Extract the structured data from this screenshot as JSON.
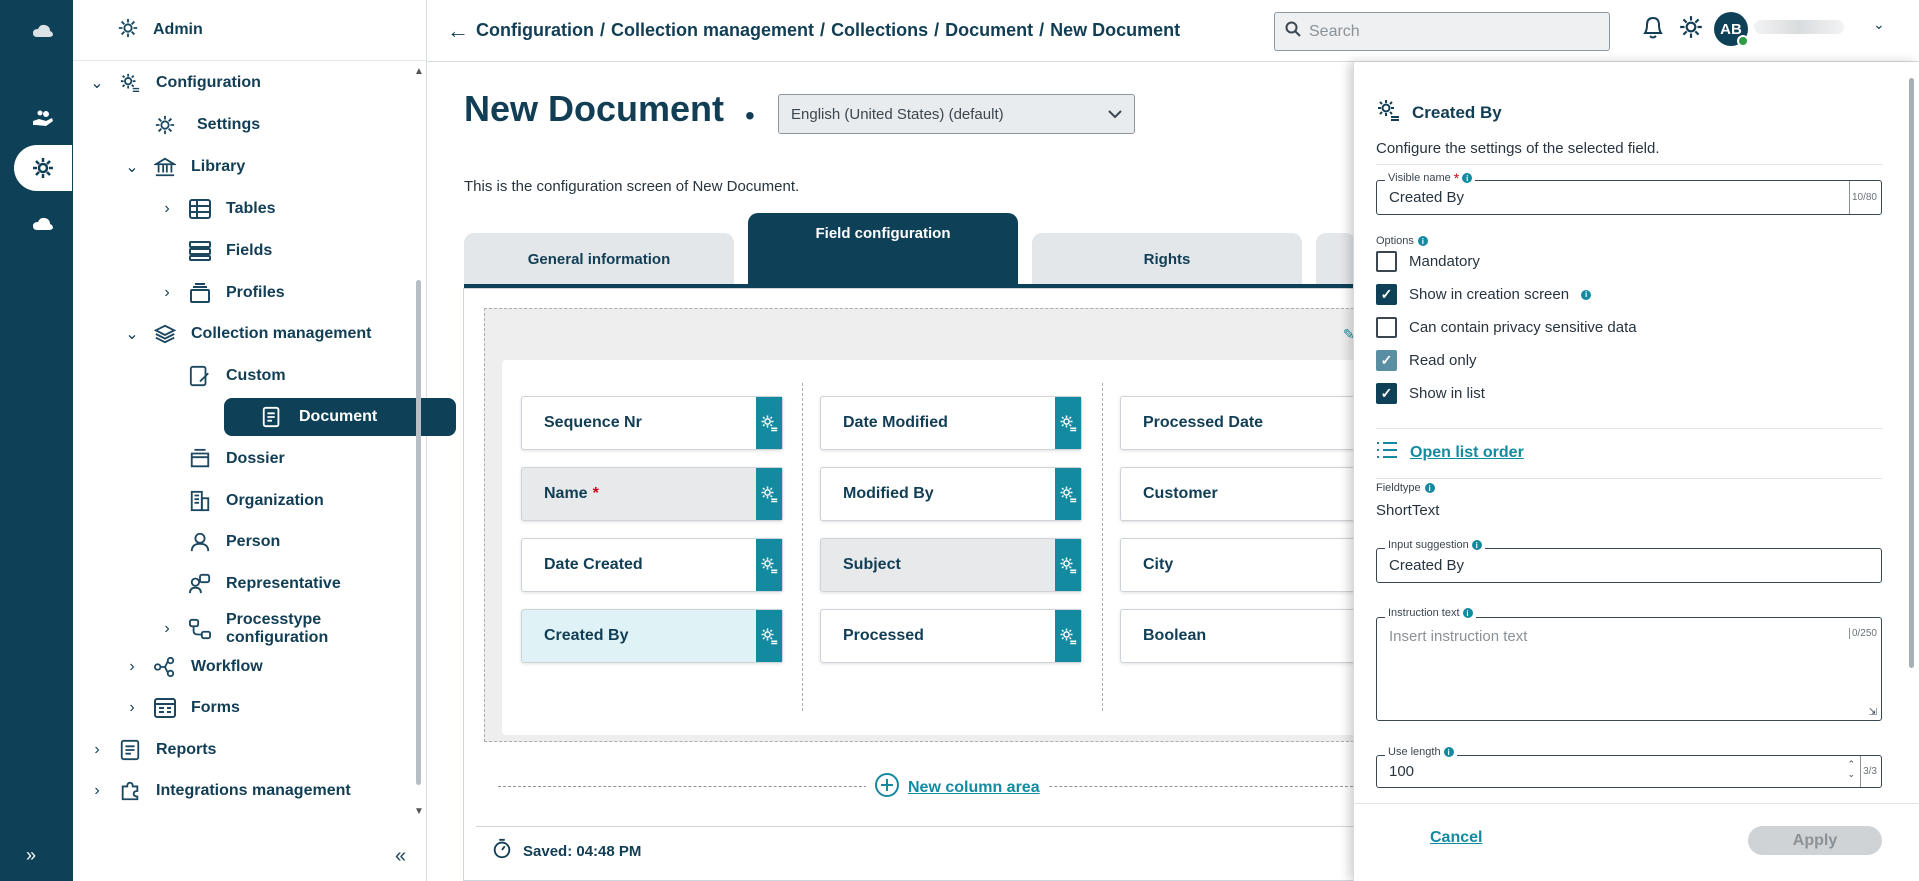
{
  "sidebar": {
    "header": "Admin",
    "items": [
      {
        "label": "Configuration"
      },
      {
        "label": "Settings"
      },
      {
        "label": "Library"
      },
      {
        "label": "Tables"
      },
      {
        "label": "Fields"
      },
      {
        "label": "Profiles"
      },
      {
        "label": "Collection management"
      },
      {
        "label": "Custom"
      },
      {
        "label": "Document"
      },
      {
        "label": "Dossier"
      },
      {
        "label": "Organization"
      },
      {
        "label": "Person"
      },
      {
        "label": "Representative"
      },
      {
        "label": "Processtype",
        "label2": "configuration"
      },
      {
        "label": "Workflow"
      },
      {
        "label": "Forms"
      },
      {
        "label": "Reports"
      },
      {
        "label": "Integrations management"
      }
    ]
  },
  "topbar": {
    "breadcrumb": [
      "Configuration",
      "Collection management",
      "Collections",
      "Document",
      "New Document"
    ],
    "search_placeholder": "Search",
    "avatar_initials": "AB"
  },
  "main": {
    "title": "New Document",
    "title_dot": "•",
    "language": "English (United States) (default)",
    "description": "This is the configuration screen of New Document.",
    "tabs": [
      {
        "label": "General information"
      },
      {
        "label": "Field configuration"
      },
      {
        "label": "Rights"
      }
    ],
    "columns": [
      [
        {
          "label": "Sequence Nr"
        },
        {
          "label": "Name"
        },
        {
          "label": "Date Created"
        },
        {
          "label": "Created By"
        }
      ],
      [
        {
          "label": "Date Modified"
        },
        {
          "label": "Modified By"
        },
        {
          "label": "Subject"
        },
        {
          "label": "Processed"
        }
      ],
      [
        {
          "label": "Processed Date"
        },
        {
          "label": "Customer"
        },
        {
          "label": "City"
        },
        {
          "label": "Boolean"
        }
      ]
    ],
    "required_mark": "*",
    "new_column": "New column area",
    "saved": "Saved: 04:48 PM"
  },
  "panel": {
    "title": "Created By",
    "subtitle": "Configure the settings of the selected field.",
    "visible_name_label": "Visible name",
    "visible_name_value": "Created By",
    "visible_name_counter": "10/80",
    "options_label": "Options",
    "options": [
      {
        "label": "Mandatory",
        "checked": false
      },
      {
        "label": "Show in creation screen",
        "checked": true
      },
      {
        "label": "Can contain privacy sensitive data",
        "checked": false
      },
      {
        "label": "Read only",
        "checked": true
      },
      {
        "label": "Show in list",
        "checked": true
      }
    ],
    "open_list_order": "Open list order",
    "fieldtype_label": "Fieldtype",
    "fieldtype_value": "ShortText",
    "input_suggestion_label": "Input suggestion",
    "input_suggestion_value": "Created By",
    "instruction_label": "Instruction text",
    "instruction_placeholder": "Insert instruction text",
    "instruction_counter": "0/250",
    "use_length_label": "Use length",
    "use_length_value": "100",
    "use_length_counter": "3/3",
    "cancel": "Cancel",
    "apply": "Apply"
  }
}
